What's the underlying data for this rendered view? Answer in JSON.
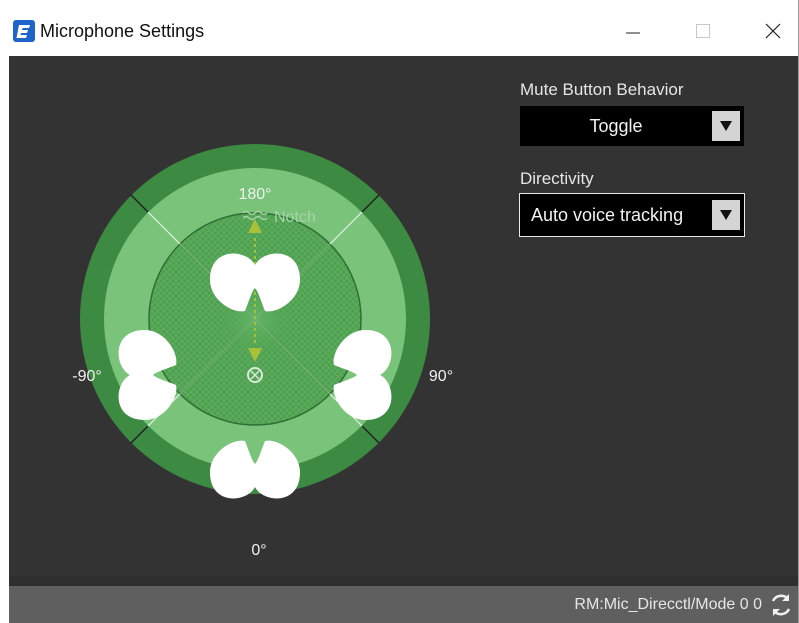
{
  "window": {
    "title": "Microphone Settings",
    "controls": [
      "minimize",
      "maximize",
      "close"
    ]
  },
  "polar_view": {
    "angle_labels": {
      "top": "180°",
      "bottom": "0°",
      "left": "-90°",
      "right": "90°"
    },
    "notch_label": "Notch",
    "colors": {
      "outer_ring": "#3d8a42",
      "middle_ring": "#79c37b",
      "inner_disc": "#4fa251",
      "lobe": "#ffffff",
      "notch": "#a8c03a"
    }
  },
  "settings": {
    "mute_button_behavior": {
      "label": "Mute Button Behavior",
      "value": "Toggle"
    },
    "directivity": {
      "label": "Directivity",
      "value": "Auto voice tracking"
    }
  },
  "status_bar": {
    "text": "RM:Mic_Direcctl/Mode 0 0"
  }
}
